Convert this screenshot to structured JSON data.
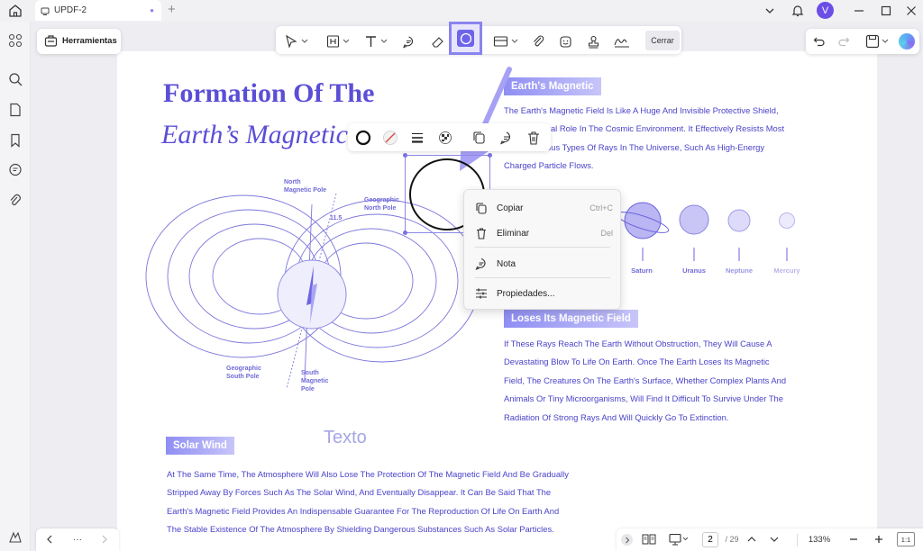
{
  "app": {
    "tab_title": "UPDF-2",
    "avatar_initial": "V"
  },
  "toolbar": {
    "tools_label": "Herramientas",
    "close_label": "Cerrar"
  },
  "document": {
    "headline_line1": "Formation Of The",
    "headline_line2": "Earth’s Magnetic",
    "sections": {
      "earths_magnetic": {
        "heading": "Earth's Magnetic",
        "lines": [
          "The Earth's Magnetic Field Is Like A Huge And Invisible Protective Shield,",
          "Playing A Vital Role In The Cosmic Environment. It Effectively Resists Most",
          "Of The Various Types Of Rays In The Universe, Such As High-Energy",
          "Charged Particle Flows."
        ]
      },
      "loses_field": {
        "heading": "Loses Its Magnetic Field",
        "lines": [
          "If These Rays Reach The Earth Without Obstruction, They Will Cause A",
          "Devastating Blow To Life On Earth. Once The Earth Loses Its Magnetic",
          "Field, The Creatures On The Earth's Surface, Whether Complex Plants And",
          "Animals Or Tiny Microorganisms, Will Find It Difficult To Survive Under The",
          "Radiation Of Strong Rays And Will Quickly Go To Extinction."
        ]
      },
      "solar_wind": {
        "heading": "Solar Wind",
        "lines": [
          "At The Same Time, The Atmosphere Will Also Lose The Protection Of The Magnetic Field And Be Gradually",
          "Stripped Away By Forces Such As The Solar Wind, And Eventually Disappear. It Can Be Said That The",
          "Earth's Magnetic Field Provides An Indispensable Guarantee For The Reproduction Of Life On Earth And",
          "The Stable Existence Of The Atmosphere By Shielding Dangerous Substances Such As Solar Particles."
        ]
      }
    },
    "diagram": {
      "north_magnetic_pole": [
        "North",
        "Magnetic Pole"
      ],
      "geographic_north_pole": [
        "Geographic",
        "North Pole"
      ],
      "geographic_south_pole": [
        "Geographic",
        "South Pole"
      ],
      "south_magnetic_pole": [
        "South",
        "Magnetic",
        "Pole"
      ],
      "angle": "11.5"
    },
    "planets": [
      "Saturn",
      "Uranus",
      "Neptune",
      "Mercury"
    ],
    "placeholder_text": "Texto"
  },
  "context_menu": {
    "copy": "Copiar",
    "copy_shortcut": "Ctrl+C",
    "delete": "Eliminar",
    "delete_shortcut": "Del",
    "note": "Nota",
    "properties": "Propiedades..."
  },
  "bottom_bar": {
    "ellipsis": "···",
    "page_current": "2",
    "page_total": "/ 29",
    "zoom": "133%",
    "fit": "1:1"
  },
  "colors": {
    "accent": "#5b4ed6",
    "text_blue": "#4a43c8",
    "selected_tool": "#6e64ea"
  }
}
